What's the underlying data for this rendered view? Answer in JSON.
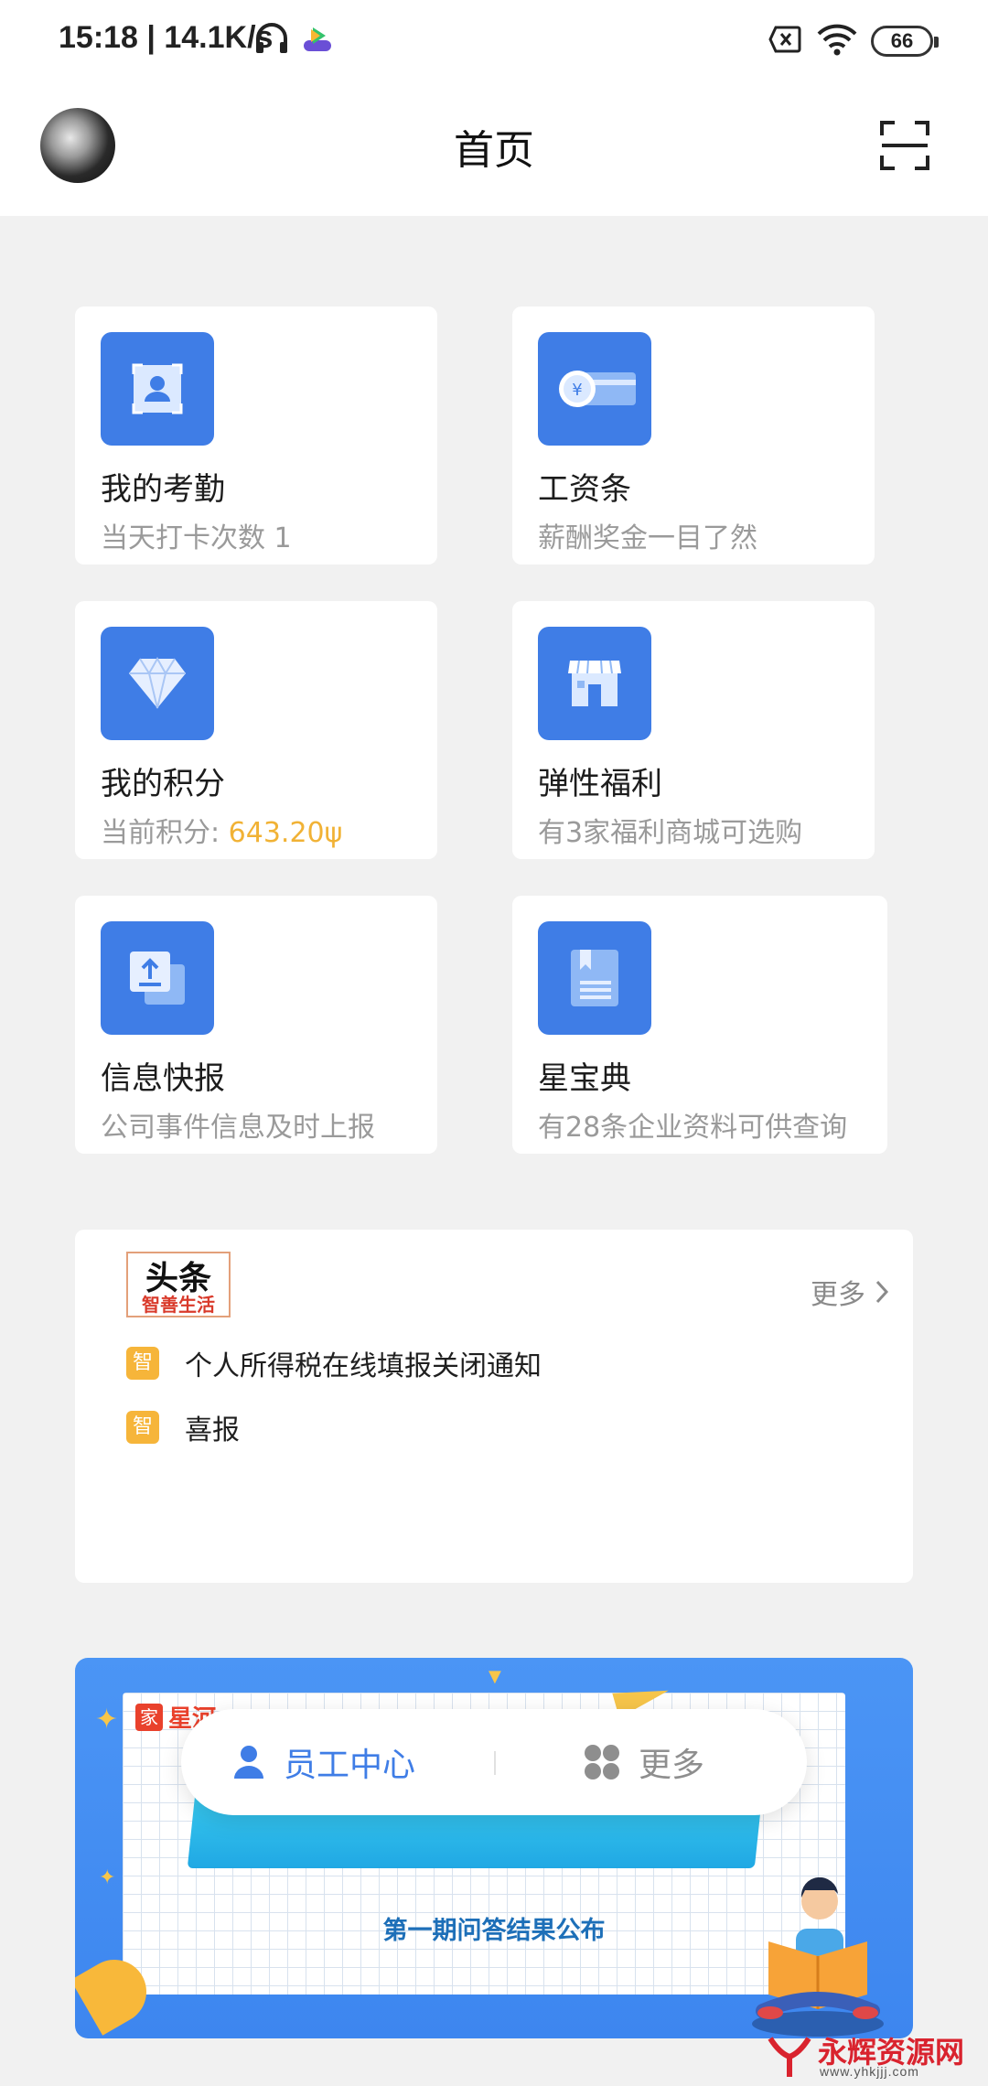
{
  "status_bar": {
    "time": "15:18 | 14.1K/s",
    "battery": "66"
  },
  "header": {
    "title": "首页"
  },
  "cards": [
    {
      "title": "我的考勤",
      "subtitle": "当天打卡次数 1",
      "icon": "attendance-icon"
    },
    {
      "title": "工资条",
      "subtitle": "薪酬奖金一目了然",
      "icon": "payslip-icon"
    },
    {
      "title": "我的积分",
      "subtitle_prefix": "当前积分: ",
      "subtitle_value": "643.20ψ",
      "icon": "diamond-icon"
    },
    {
      "title": "弹性福利",
      "subtitle": "有3家福利商城可选购",
      "icon": "store-icon"
    },
    {
      "title": "信息快报",
      "subtitle": "公司事件信息及时上报",
      "icon": "upload-report-icon"
    },
    {
      "title": "星宝典",
      "subtitle": "有28条企业资料可供查询",
      "icon": "book-icon"
    }
  ],
  "news": {
    "logo_line1": "头条",
    "logo_line2": "智善生活",
    "more": "更多",
    "badge": "智",
    "items": [
      "个人所得税在线填报关闭通知",
      "喜报"
    ]
  },
  "banner": {
    "brand_badge": "家",
    "brand_name": "星河",
    "subtitle": "第一期问答结果公布"
  },
  "bottom_pill": {
    "left_label": "员工中心",
    "right_label": "更多"
  },
  "watermark": {
    "title": "永辉资源网",
    "url": "www.yhkjjj.com"
  },
  "colors": {
    "accent": "#3f7de6",
    "points": "#f1b235",
    "badge": "#f6b53a",
    "background": "#f1f1f1"
  }
}
